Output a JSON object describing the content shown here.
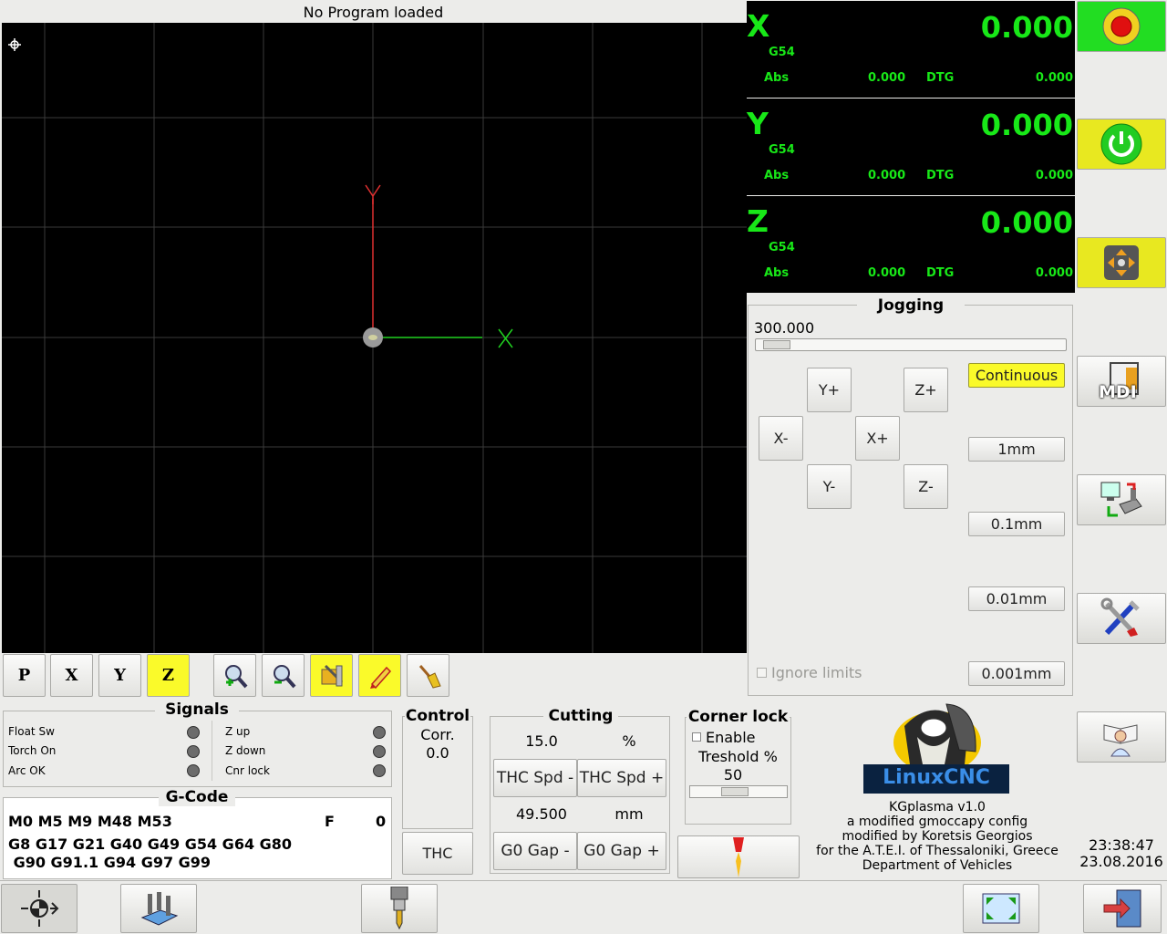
{
  "preview": {
    "title": "No Program loaded",
    "axis_x": "X",
    "axis_y": "Y"
  },
  "view_buttons": {
    "p": "P",
    "x": "X",
    "y": "Y",
    "z": "Z"
  },
  "dro": [
    {
      "axis": "X",
      "value": "0.000",
      "coord": "G54",
      "abs_label": "Abs",
      "abs": "0.000",
      "dtg_label": "DTG",
      "dtg": "0.000"
    },
    {
      "axis": "Y",
      "value": "0.000",
      "coord": "G54",
      "abs_label": "Abs",
      "abs": "0.000",
      "dtg_label": "DTG",
      "dtg": "0.000"
    },
    {
      "axis": "Z",
      "value": "0.000",
      "coord": "G54",
      "abs_label": "Abs",
      "abs": "0.000",
      "dtg_label": "DTG",
      "dtg": "0.000"
    }
  ],
  "jogging": {
    "title": "Jogging",
    "speed": "300.000",
    "speed_fraction": 0.1,
    "buttons": {
      "yplus": "Y+",
      "zplus": "Z+",
      "xminus": "X-",
      "xplus": "X+",
      "yminus": "Y-",
      "zminus": "Z-"
    },
    "increments": [
      "Continuous",
      "1mm",
      "0.1mm",
      "0.01mm",
      "0.001mm"
    ],
    "ignore_limits": "Ignore limits"
  },
  "signals": {
    "title": "Signals",
    "left": [
      "Float Sw",
      "Torch On",
      "Arc OK"
    ],
    "right": [
      "Z up",
      "Z down",
      "Cnr lock"
    ]
  },
  "gcode": {
    "title": "G-Code",
    "line1": "M0 M5 M9 M48 M53",
    "f_label": "F",
    "f_value": "0",
    "line2": "G8 G17 G21 G40 G49 G54 G64 G80",
    "line3": " G90 G91.1 G94 G97 G99"
  },
  "control": {
    "title": "Control",
    "corr_label": "Corr.",
    "corr_value": "0.0",
    "thc": "THC"
  },
  "cutting": {
    "title": "Cutting",
    "thc_value": "15.0",
    "thc_unit": "%",
    "thc_minus": "THC Spd -",
    "thc_plus": "THC Spd +",
    "gap_value": "49.500",
    "gap_unit": "mm",
    "gap_minus": "G0 Gap -",
    "gap_plus": "G0 Gap +"
  },
  "corner_lock": {
    "title": "Corner lock",
    "enable": "Enable",
    "treshold": "Treshold %",
    "value": "50",
    "slider_fraction": 0.5
  },
  "logo": {
    "text": "LinuxCNC"
  },
  "about": {
    "line1": "KGplasma v1.0",
    "line2": "a modified gmoccapy config",
    "line3": "modified by Koretsis Georgios",
    "line4": "for the A.T.E.I. of Thessaloniki, Greece",
    "line5": "Department of Vehicles"
  },
  "clock": {
    "time": "23:38:47",
    "date": "23.08.2016"
  },
  "side": {
    "mdi": "MDI"
  },
  "colors": {
    "dro_green": "#18e818",
    "estop_green": "#22dd22",
    "highlight_yellow": "#fafa2a"
  }
}
